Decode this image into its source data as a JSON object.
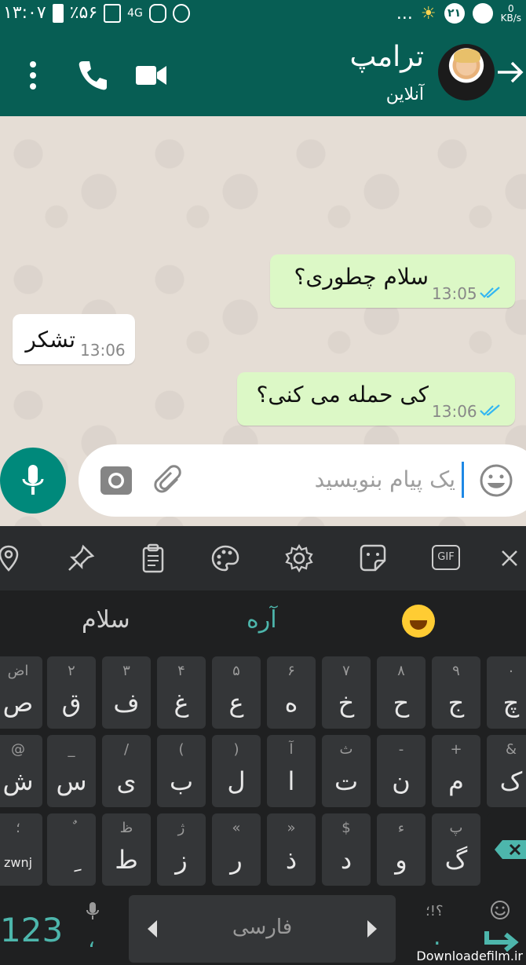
{
  "status_bar": {
    "time": "۱۳:۰۷",
    "battery": "٪۵۶",
    "network": "4G",
    "signal_badge": "۲۱",
    "kb_rate_top": "0",
    "kb_rate_bottom": "KB/s",
    "dots": "..."
  },
  "header": {
    "contact_name": "ترامپ",
    "status": "آنلاین"
  },
  "messages": [
    {
      "direction": "out",
      "text": "سلام چطوری؟",
      "time": "13:05",
      "read": true
    },
    {
      "direction": "in",
      "text": "تشکر",
      "time": "13:06"
    },
    {
      "direction": "out",
      "text": "کی حمله می کنی؟",
      "time": "13:06",
      "read": true
    }
  ],
  "composer": {
    "placeholder": "یک پیام بنویسید"
  },
  "keyboard": {
    "toolbar_icons": [
      "location-icon",
      "pin-icon",
      "clipboard-icon",
      "palette-icon",
      "settings-icon",
      "sticker-icon",
      "gif-icon",
      "close-icon"
    ],
    "gif_label": "GIF",
    "suggestions": {
      "left": "سلام",
      "middle": "آره",
      "right_emoji": "laughing-emoji"
    },
    "rows": [
      [
        {
          "main": "ص",
          "hint": "اض"
        },
        {
          "main": "ق",
          "hint": "۲"
        },
        {
          "main": "ف",
          "hint": "۳"
        },
        {
          "main": "غ",
          "hint": "۴"
        },
        {
          "main": "ع",
          "hint": "۵"
        },
        {
          "main": "ه",
          "hint": "۶"
        },
        {
          "main": "خ",
          "hint": "۷"
        },
        {
          "main": "ح",
          "hint": "۸"
        },
        {
          "main": "ج",
          "hint": "۹"
        },
        {
          "main": "چ",
          "hint": "۰"
        }
      ],
      [
        {
          "main": "ش",
          "hint": "@"
        },
        {
          "main": "س",
          "hint": "_"
        },
        {
          "main": "ی",
          "hint": "/"
        },
        {
          "main": "ب",
          "hint": "("
        },
        {
          "main": "ل",
          "hint": ")"
        },
        {
          "main": "ا",
          "hint": "آ"
        },
        {
          "main": "ت",
          "hint": "ث"
        },
        {
          "main": "ن",
          "hint": "-"
        },
        {
          "main": "م",
          "hint": "+"
        },
        {
          "main": "ک",
          "hint": "&"
        }
      ],
      [
        {
          "main": "zwnj",
          "hint": "؛"
        },
        {
          "main": "ِ",
          "hint": "ٌ"
        },
        {
          "main": "ط",
          "hint": "ظ"
        },
        {
          "main": "ز",
          "hint": "ژ"
        },
        {
          "main": "ر",
          "hint": "«"
        },
        {
          "main": "ذ",
          "hint": "»"
        },
        {
          "main": "د",
          "hint": "$"
        },
        {
          "main": "و",
          "hint": "ء"
        },
        {
          "main": "گ",
          "hint": "پ"
        }
      ]
    ],
    "num_key": "123",
    "comma_key": "،",
    "space_label": "فارسی",
    "punct_top": "؟!؛",
    "punct_bottom": "."
  },
  "watermark": "Downloadefilm.ir"
}
